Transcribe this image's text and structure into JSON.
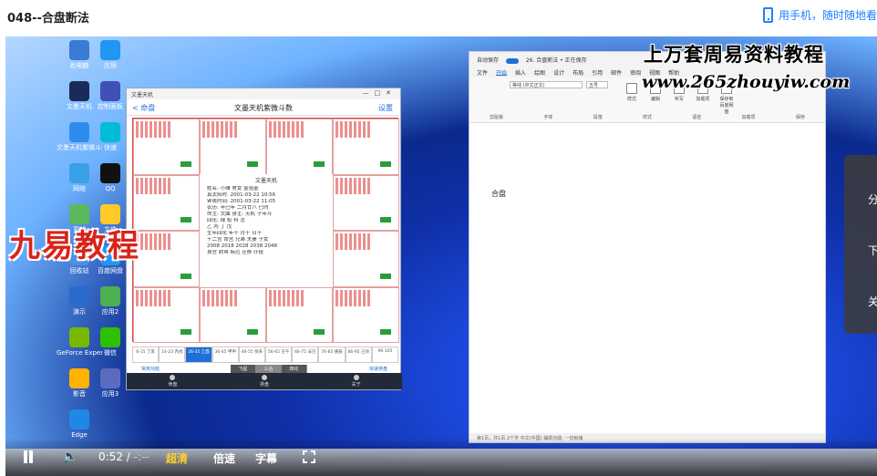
{
  "page": {
    "title": "048--合盘断法",
    "phone_link": "用手机，随时随地看"
  },
  "desktop": {
    "icons": [
      "此电脑",
      "文墨天机",
      "文墨天机紫微斗数",
      "网络",
      "更新",
      "回收站",
      "演示",
      "GeForce Experience",
      "影音",
      "Edge",
      "应用",
      "控制面板",
      "快速",
      "QQ",
      "文件",
      "百度网盘",
      "应用2",
      "微信",
      "应用3"
    ]
  },
  "ziwei_app": {
    "window_title": "文墨天机",
    "back": "< 命盘",
    "title": "文墨天机紫微斗数",
    "settings": "设置",
    "center_title": "文墨天机",
    "center_lines": [
      "姓名: 小雅   男女 金箔金",
      "真太阳时: 2001-03-22 10:56",
      "钟表时间: 2001-03-22 11:05",
      "农历: 辛巳年 二月廿八 巳时",
      "命主: 文曲 身主: 天机 子年斗",
      "四化: 禄 权 科 忌",
      "乙 丙 丁 戊",
      "生年四化 年干 月干 日干",
      "十二宫 命宫 兄弟 夫妻 子女",
      "2008 2018 2028 2038 2048",
      "身宫 财帛 疾厄 迁移 仆役"
    ],
    "decades": [
      "6-15 丁亥",
      "14-23 丙戌",
      "26-35 乙酉",
      "36-45 甲申",
      "46-55 癸未",
      "56-65 壬午",
      "66-75 辛巳",
      "76-85 庚辰",
      "86-95 己卯",
      "96-105"
    ],
    "decade_selected": 2,
    "tool_left": "常用功能",
    "seg": [
      "飞星",
      "三合",
      "四化"
    ],
    "seg_selected": 1,
    "tool_right": "快速排盘",
    "bottom": [
      "命盘",
      "排盘",
      "关于"
    ]
  },
  "brand_overlay": "九易教程",
  "word": {
    "autosave": "自动保存",
    "doc_title": "26. 合盘断法 • 正在保存",
    "tabs": [
      "文件",
      "开始",
      "插入",
      "绘图",
      "设计",
      "布局",
      "引用",
      "邮件",
      "审阅",
      "视图",
      "帮助"
    ],
    "tab_selected": 1,
    "font": "等线 (中文正文)",
    "size": "五号",
    "buttons": [
      "样式",
      "编辑",
      "听写",
      "加载项",
      "保存到百度网盘"
    ],
    "groups": [
      "剪贴板",
      "字体",
      "段落",
      "样式",
      "语音",
      "加载项",
      "保存"
    ],
    "body_text": "合盘",
    "status": "第1页，共1页  2个字  中文(中国)  辅助功能: 一切就绪"
  },
  "watermark": {
    "line1": "上万套周易资料教程",
    "line2": "www.265zhouyiw.com"
  },
  "side_panel": [
    "分",
    "下",
    "关"
  ],
  "player": {
    "current_time": "0:52",
    "separator": "/",
    "duration": "-:--",
    "quality": "超清",
    "speed": "倍速",
    "subtitle": "字幕"
  }
}
